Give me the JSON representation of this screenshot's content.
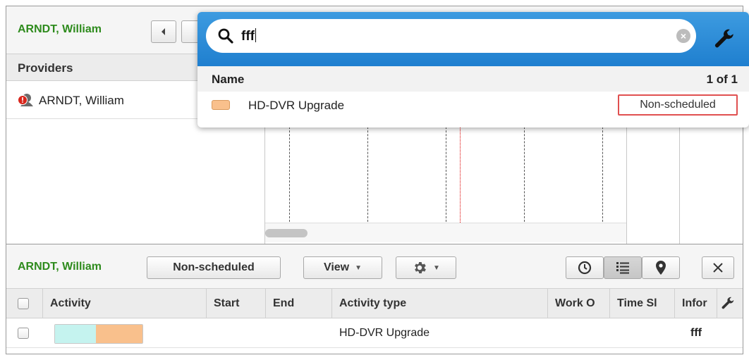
{
  "top": {
    "provider_name": "ARNDT, William",
    "providers_header": "Providers",
    "provider_row_name": "ARNDT, William"
  },
  "search": {
    "query": "fff",
    "column_name": "Name",
    "count": "1 of 1",
    "result_name": "HD-DVR Upgrade",
    "result_status": "Non-scheduled"
  },
  "bottom": {
    "provider_name": "ARNDT, William",
    "filter_button": "Non-scheduled",
    "view_button": "View",
    "columns": [
      "Activity",
      "Start",
      "End",
      "Activity type",
      "Work O",
      "Time Sl",
      "Infor"
    ],
    "row": {
      "activity_type": "HD-DVR Upgrade",
      "info": "fff"
    }
  },
  "colors": {
    "accent_green": "#2e8b1d",
    "popup_blue": "#2b8ad8",
    "activity_orange": "#f9c08c",
    "activity_cyan": "#c5f3ef",
    "highlight_red": "#e05050"
  }
}
